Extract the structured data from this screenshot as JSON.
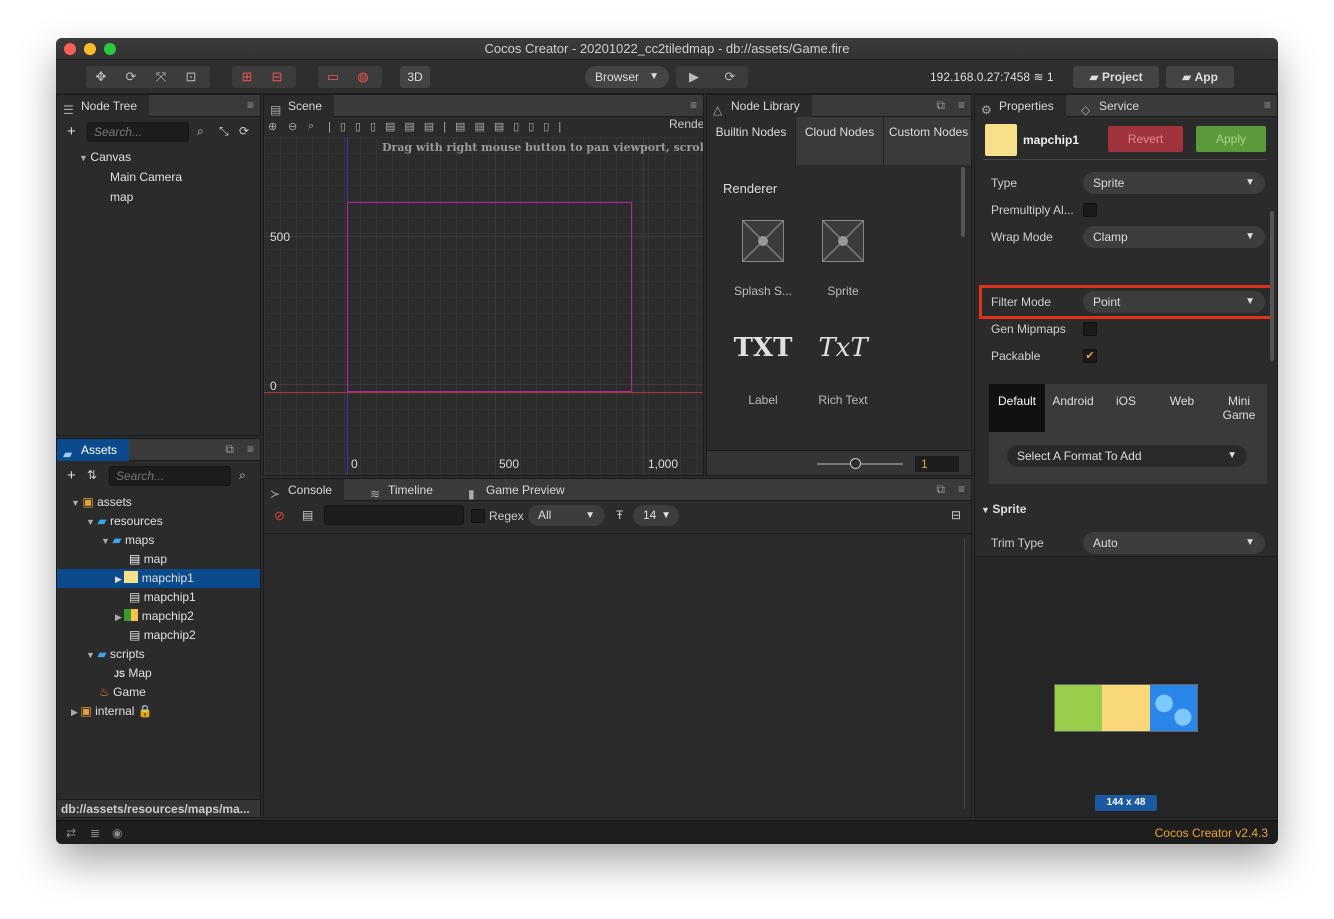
{
  "window": {
    "title": "Cocos Creator - 20201022_cc2tiledmap - db://assets/Game.fire"
  },
  "colors": {
    "accent_blue": "#0b4b8c",
    "revert_red": "#a0333b",
    "apply_green": "#5a9a3a",
    "highlight_red": "#e0301e",
    "swatch_yellow": "#f8e08a",
    "version_orange": "#e8a23a"
  },
  "toolbar": {
    "mode_3d": "3D",
    "preview_target": "Browser",
    "ip": "192.168.0.27:7458",
    "connections": "1",
    "project": "Project",
    "app": "App"
  },
  "node_tree": {
    "title": "Node Tree",
    "search_placeholder": "Search...",
    "items": [
      "Canvas",
      "Main Camera",
      "map"
    ]
  },
  "scene": {
    "title": "Scene",
    "hint": "Drag with right mouse button to pan viewport, scroll to zoom.",
    "render_label": "Rende",
    "y_labels": [
      "500",
      "0"
    ],
    "x_labels": [
      "0",
      "500",
      "1,000"
    ]
  },
  "node_library": {
    "title": "Node Library",
    "tabs": [
      "Builtin Nodes",
      "Cloud Nodes",
      "Custom Nodes"
    ],
    "section": "Renderer",
    "items": [
      "Splash S...",
      "Sprite",
      "Label",
      "Rich Text"
    ],
    "label_icon_text": "TXT",
    "rich_icon_text": "TxT",
    "zoom_value": "1"
  },
  "assets": {
    "title": "Assets",
    "search_placeholder": "Search...",
    "tree": [
      "assets",
      "resources",
      "maps",
      "map",
      "mapchip1",
      "mapchip1",
      "mapchip2",
      "mapchip2",
      "scripts",
      "Map",
      "Game",
      "internal"
    ],
    "path": "db://assets/resources/maps/ma..."
  },
  "console": {
    "tabs": [
      "Console",
      "Timeline",
      "Game Preview"
    ],
    "regex_label": "Regex",
    "level": "All",
    "font_size": "14"
  },
  "properties": {
    "tabs": [
      "Properties",
      "Service"
    ],
    "asset_name": "mapchip1",
    "revert": "Revert",
    "apply": "Apply",
    "rows": [
      {
        "label": "Type",
        "value": "Sprite"
      },
      {
        "label": "Premultiply Al...",
        "value": ""
      },
      {
        "label": "Wrap Mode",
        "value": "Clamp"
      },
      {
        "label": "Filter Mode",
        "value": "Point"
      },
      {
        "label": "Gen Mipmaps",
        "value": ""
      },
      {
        "label": "Packable",
        "value": ""
      }
    ],
    "platform_tabs": [
      "Default",
      "Android",
      "iOS",
      "Web",
      "Mini Game"
    ],
    "format_select": "Select A Format To Add",
    "sprite_section": "Sprite",
    "trim_label": "Trim Type",
    "trim_value": "Auto",
    "preview_size": "144 x 48"
  },
  "status": {
    "version": "Cocos Creator v2.4.3"
  }
}
